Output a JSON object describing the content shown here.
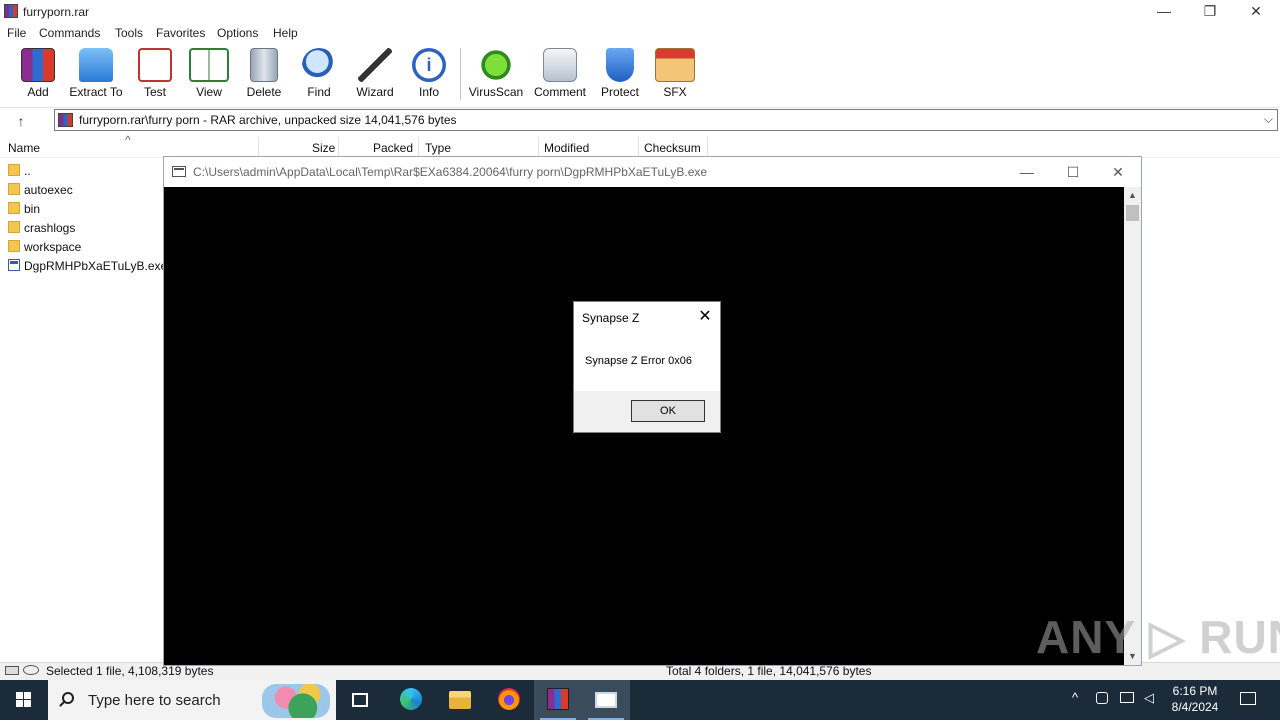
{
  "window": {
    "title": "furryporn.rar",
    "min_glyph": "—",
    "max_glyph": "❐",
    "close_glyph": "✕"
  },
  "menu": [
    "File",
    "Commands",
    "Tools",
    "Favorites",
    "Options",
    "Help"
  ],
  "toolbar": [
    {
      "label": "Add",
      "icon": "add-archive-icon"
    },
    {
      "label": "Extract To",
      "icon": "extract-folder-icon"
    },
    {
      "label": "Test",
      "icon": "test-clipboard-icon"
    },
    {
      "label": "View",
      "icon": "view-book-icon"
    },
    {
      "label": "Delete",
      "icon": "trash-icon"
    },
    {
      "label": "Find",
      "icon": "magnifier-icon"
    },
    {
      "label": "Wizard",
      "icon": "magic-wand-icon"
    },
    {
      "label": "Info",
      "icon": "info-icon"
    },
    {
      "label": "VirusScan",
      "icon": "bug-icon"
    },
    {
      "label": "Comment",
      "icon": "comment-icon"
    },
    {
      "label": "Protect",
      "icon": "shield-icon"
    },
    {
      "label": "SFX",
      "icon": "sfx-box-icon"
    }
  ],
  "address": {
    "path": "furryporn.rar\\furry porn - RAR archive, unpacked size 14,041,576 bytes",
    "up_glyph": "↑",
    "dropdown_glyph": "⌵"
  },
  "columns": {
    "name": "Name",
    "size": "Size",
    "packed": "Packed",
    "type": "Type",
    "modified": "Modified",
    "checksum": "Checksum",
    "sort_glyph": "^"
  },
  "files": [
    {
      "name": "..",
      "kind": "folder"
    },
    {
      "name": "autoexec",
      "kind": "folder"
    },
    {
      "name": "bin",
      "kind": "folder"
    },
    {
      "name": "crashlogs",
      "kind": "folder"
    },
    {
      "name": "workspace",
      "kind": "folder"
    },
    {
      "name": "DgpRMHPbXaETuLyB.exe",
      "kind": "exe"
    }
  ],
  "status": {
    "left": "Selected 1 file, 4,108,319 bytes",
    "right": "Total 4 folders, 1 file, 14,041,576 bytes"
  },
  "console": {
    "title": "C:\\Users\\admin\\AppData\\Local\\Temp\\Rar$EXa6384.20064\\furry porn\\DgpRMHPbXaETuLyB.exe",
    "min_glyph": "—",
    "max_glyph": "☐",
    "close_glyph": "✕",
    "scroll_up": "▲",
    "scroll_down": "▼"
  },
  "dialog": {
    "title": "Synapse Z",
    "message": "Synapse Z Error 0x06",
    "ok": "OK",
    "close_glyph": "✕"
  },
  "watermark": "ANY ▷ RUN",
  "taskbar": {
    "search_placeholder": "Type here to search",
    "time": "6:16 PM",
    "date": "8/4/2024"
  }
}
